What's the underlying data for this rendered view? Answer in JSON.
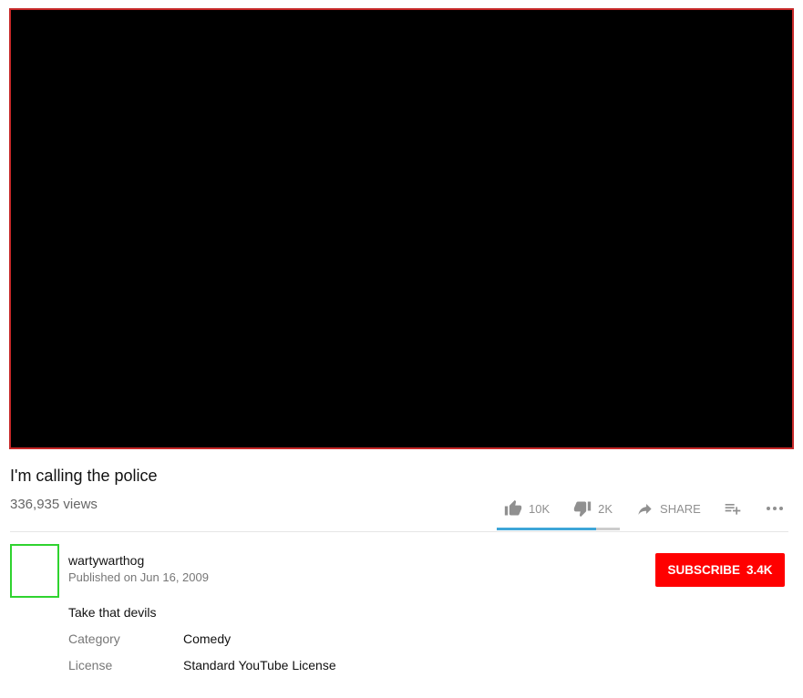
{
  "video": {
    "title": "I'm calling the police",
    "views": "336,935 views"
  },
  "actions": {
    "like_count": "10K",
    "dislike_count": "2K",
    "share_label": "SHARE",
    "like_fraction": 0.81,
    "icons": {
      "like": "thumbs-up-icon",
      "dislike": "thumbs-down-icon",
      "share": "share-arrow-icon",
      "add_to": "playlist-add-icon",
      "more": "more-dots-icon"
    }
  },
  "channel": {
    "name": "wartywarthog",
    "published": "Published on Jun 16, 2009",
    "subscribe_label": "SUBSCRIBE",
    "subscriber_count": "3.4K"
  },
  "description": {
    "text": "Take that devils",
    "metadata": [
      {
        "key": "Category",
        "value": "Comedy"
      },
      {
        "key": "License",
        "value": "Standard YouTube License"
      }
    ]
  },
  "colors": {
    "subscribe_bg": "#ff0000",
    "sentiment_like": "#3ea6d8",
    "sentiment_dislike": "#cccccc",
    "player_border": "#c62828",
    "avatar_border": "#2fd32f"
  }
}
